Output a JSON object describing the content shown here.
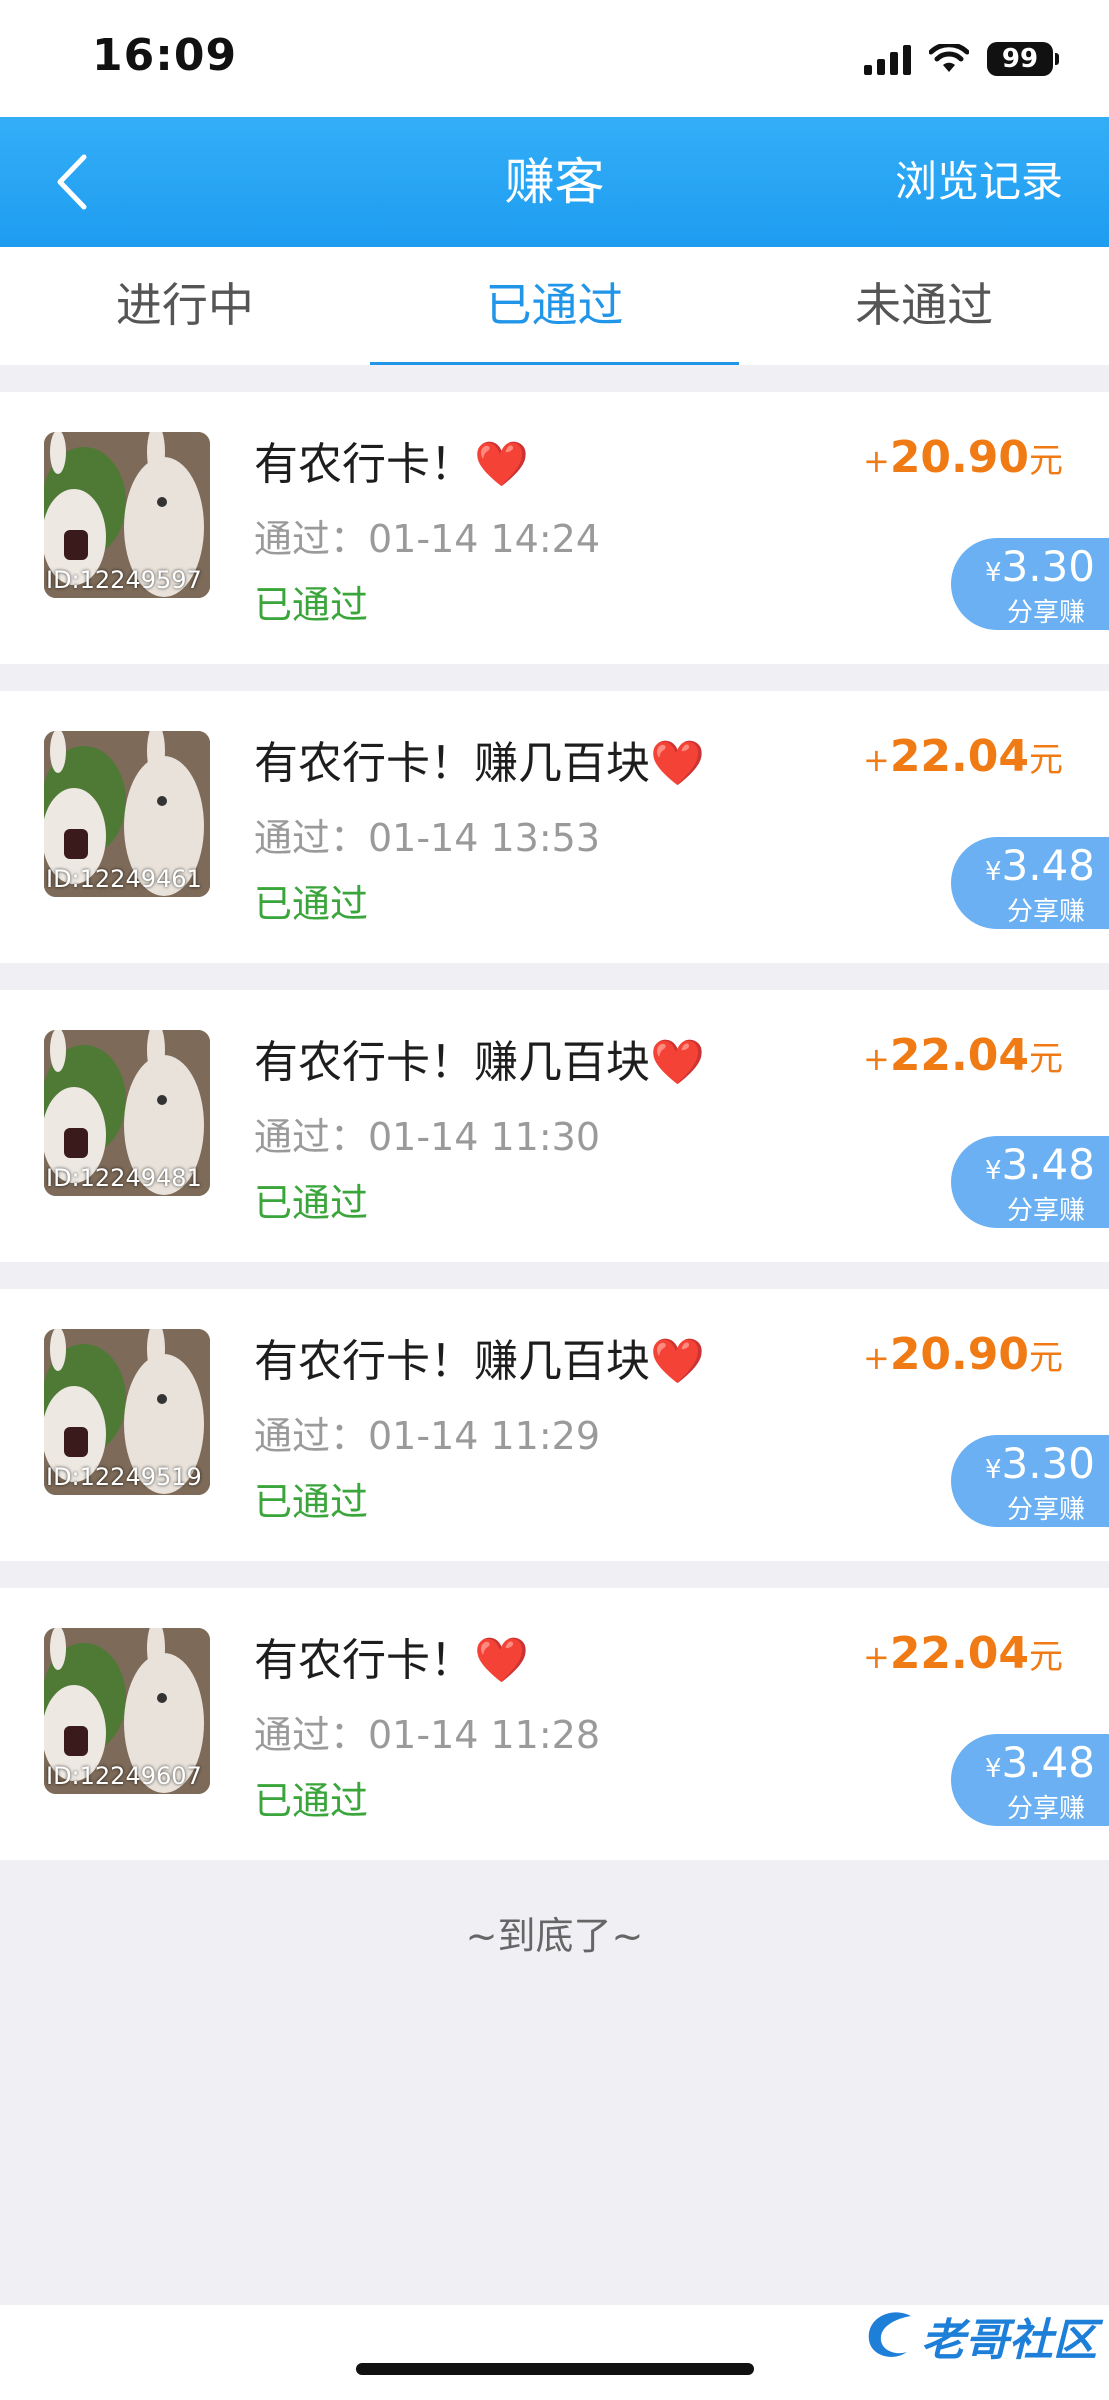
{
  "status_bar": {
    "time": "16:09",
    "battery": "99"
  },
  "nav": {
    "title": "赚客",
    "right_label": "浏览记录"
  },
  "tabs": [
    {
      "label": "进行中",
      "active": false
    },
    {
      "label": "已通过",
      "active": true
    },
    {
      "label": "未通过",
      "active": false
    }
  ],
  "items": [
    {
      "id_label": "ID:12249597",
      "title": "有农行卡！",
      "heart": "❤️",
      "time": "通过：01-14 14:24",
      "status": "已通过",
      "amount_sign": "+",
      "amount": "20.90",
      "amount_unit": "元",
      "share_currency": "¥",
      "share_amount": "3.30",
      "share_label": "分享赚"
    },
    {
      "id_label": "ID:12249461",
      "title": "有农行卡！赚几百块",
      "heart": "❤️",
      "time": "通过：01-14 13:53",
      "status": "已通过",
      "amount_sign": "+",
      "amount": "22.04",
      "amount_unit": "元",
      "share_currency": "¥",
      "share_amount": "3.48",
      "share_label": "分享赚"
    },
    {
      "id_label": "ID:12249481",
      "title": "有农行卡！赚几百块",
      "heart": "❤️",
      "time": "通过：01-14 11:30",
      "status": "已通过",
      "amount_sign": "+",
      "amount": "22.04",
      "amount_unit": "元",
      "share_currency": "¥",
      "share_amount": "3.48",
      "share_label": "分享赚"
    },
    {
      "id_label": "ID:12249519",
      "title": "有农行卡！赚几百块",
      "heart": "❤️",
      "time": "通过：01-14 11:29",
      "status": "已通过",
      "amount_sign": "+",
      "amount": "20.90",
      "amount_unit": "元",
      "share_currency": "¥",
      "share_amount": "3.30",
      "share_label": "分享赚"
    },
    {
      "id_label": "ID:12249607",
      "title": "有农行卡！",
      "heart": "❤️",
      "time": "通过：01-14 11:28",
      "status": "已通过",
      "amount_sign": "+",
      "amount": "22.04",
      "amount_unit": "元",
      "share_currency": "¥",
      "share_amount": "3.48",
      "share_label": "分享赚"
    }
  ],
  "end_text": "~到底了~",
  "watermark": "老哥社区",
  "colors": {
    "nav_blue": "#1e9cf0",
    "tab_active": "#2196e8",
    "amount_orange": "#f07a14",
    "status_green": "#3aa53a",
    "share_blue": "#6ab0f2"
  }
}
